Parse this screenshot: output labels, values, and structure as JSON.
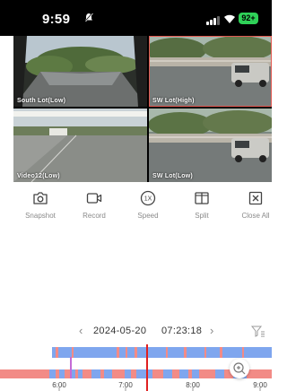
{
  "status_bar": {
    "time": "9:59",
    "battery": "92+",
    "icons": [
      "do-not-disturb-icon",
      "signal-icon",
      "wifi-icon",
      "battery-icon"
    ]
  },
  "cameras": [
    {
      "label": "South Lot(Low)",
      "selected": false
    },
    {
      "label": "SW Lot(High)",
      "selected": true
    },
    {
      "label": "Video12(Low)",
      "selected": false
    },
    {
      "label": "SW Lot(Low)",
      "selected": false
    }
  ],
  "toolbar": {
    "snapshot": "Snapshot",
    "record": "Record",
    "speed": "Speed",
    "speed_value": "1X",
    "split": "Split",
    "close_all": "Close All"
  },
  "timeline": {
    "date": "2024-05-20",
    "time": "07:23:18",
    "ticks": [
      "6:00",
      "7:00",
      "8:00",
      "9:00"
    ],
    "colors": {
      "recording": "#7fa6ee",
      "event": "#f28b86",
      "cursor": "#e02020",
      "motion": "#c46bd6"
    }
  }
}
